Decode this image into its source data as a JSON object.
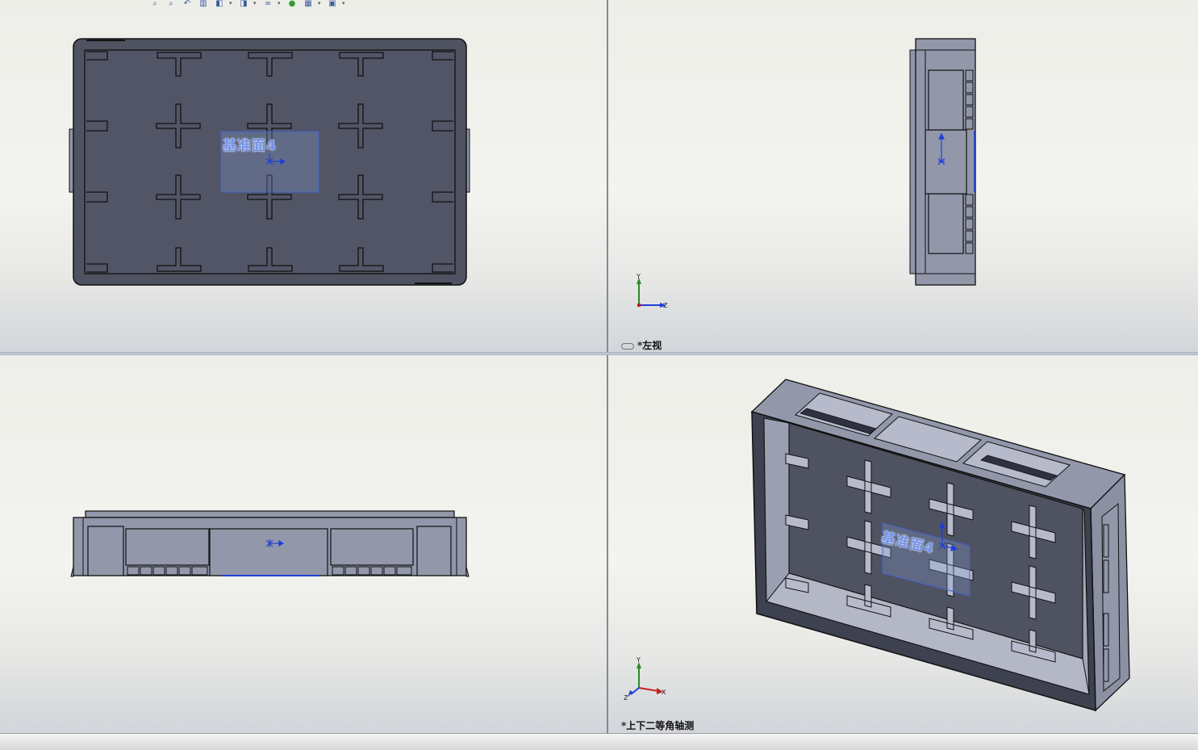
{
  "toolbar": {
    "icons": [
      "zoom-to-fit-icon",
      "zoom-area-icon",
      "previous-view-icon",
      "section-view-icon",
      "view-orientation-icon",
      "display-style-icon",
      "hide-show-icon",
      "edit-appearance-icon",
      "apply-scene-icon",
      "view-settings-icon"
    ]
  },
  "viewports": {
    "top_left": {
      "plane_label": "基准面4",
      "view_label": ""
    },
    "top_right": {
      "view_label": "*左视",
      "axis": {
        "vertical": "Y",
        "horizontal": "Z"
      }
    },
    "bottom_left": {
      "view_label": ""
    },
    "bottom_right": {
      "plane_label": "基准面4",
      "view_label": "*上下二等角轴测",
      "axis": {
        "vertical": "Y",
        "horizontal": "X",
        "depth": "Z"
      }
    }
  },
  "colors": {
    "part_dark": "#4f5260",
    "part_side": "#9096a8",
    "edge": "#111111",
    "plane_fill": "#8aa6e0",
    "plane_label": "#6f8fe8",
    "axis_y": "#2a8a2a",
    "axis_z": "#1f3fd6",
    "axis_x": "#c82020"
  }
}
